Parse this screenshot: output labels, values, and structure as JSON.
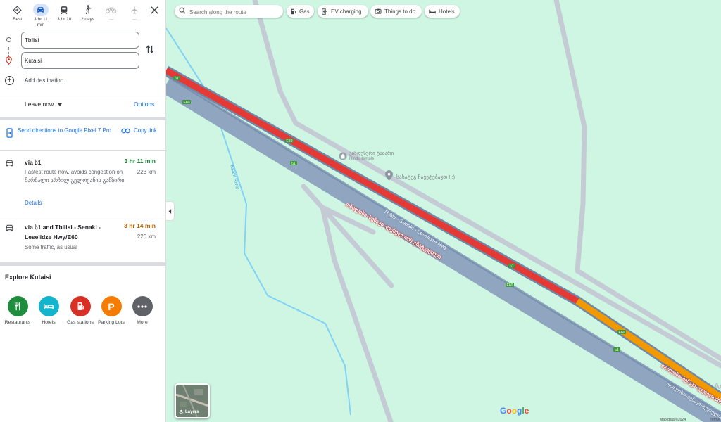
{
  "travel_modes": [
    {
      "label": "Best",
      "icon": "diamond-directions-icon"
    },
    {
      "label": "3 hr 11 min",
      "icon": "car-icon"
    },
    {
      "label": "3 hr 10",
      "icon": "train-icon"
    },
    {
      "label": "2 days",
      "icon": "walk-icon"
    },
    {
      "label": "—",
      "icon": "bike-icon"
    },
    {
      "label": "—",
      "icon": "plane-icon"
    }
  ],
  "origin": {
    "value": "Tbilisi"
  },
  "destination": {
    "value": "Kutaisi"
  },
  "add_destination": "Add destination",
  "leave_now": "Leave now",
  "options": "Options",
  "send_directions": "Send directions to Google Pixel 7 Pro",
  "copy_link": "Copy link",
  "routes": [
    {
      "via": "via ს1",
      "time": "3 hr 11 min",
      "time_color": "#188038",
      "distance": "223 km",
      "description": "Fastest route now, avoids congestion on მარშალი არჩილ გელოვანის გამზირი",
      "details": "Details"
    },
    {
      "via": "via ს1 and Tbilisi - Senaki - Leselidze Hwy/E60",
      "time": "3 hr 14 min",
      "time_color": "#b06000",
      "distance": "220 km",
      "description": "Some traffic, as usual"
    }
  ],
  "explore": {
    "title": "Explore Kutaisi",
    "items": [
      {
        "label": "Restaurants",
        "icon": "restaurant-icon",
        "color": "#1e8e3e"
      },
      {
        "label": "Hotels",
        "icon": "hotel-icon",
        "color": "#12b5cb"
      },
      {
        "label": "Gas stations",
        "icon": "gas-station-icon",
        "color": "#d93025"
      },
      {
        "label": "Parking Lots",
        "icon": "parking-icon",
        "color": "#f57c00"
      },
      {
        "label": "More",
        "icon": "more-icon",
        "color": "#5f6368"
      }
    ]
  },
  "map": {
    "search_placeholder": "Search along the route",
    "chips": [
      "Gas",
      "EV charging",
      "Things to do",
      "Hotels"
    ],
    "layers_label": "Layers",
    "place_hindu_temple_name": "ეინდუსური ტაძარი",
    "place_hindu_temple_type": "Hindu temple",
    "place_other": "სახატეგ ჩავეტებავთ ! :)",
    "river": "Ksani River",
    "road_name_ka": "თბილისი–სენაკი–ლესელიძის გზატკეცილი",
    "road_name_en": "Tbilisi - Senaki - Leselidze Hwy",
    "shield_e60": "E60",
    "shield_s1": "ს1",
    "logo": "Google",
    "map_data": "Map data ©2024",
    "terms": "Terms",
    "edge_label": "Ac",
    "colors": {
      "traffic_red": "#e53935",
      "traffic_orange": "#f29900",
      "highway": "#8fa5c0",
      "land": "#cff5e3"
    }
  }
}
